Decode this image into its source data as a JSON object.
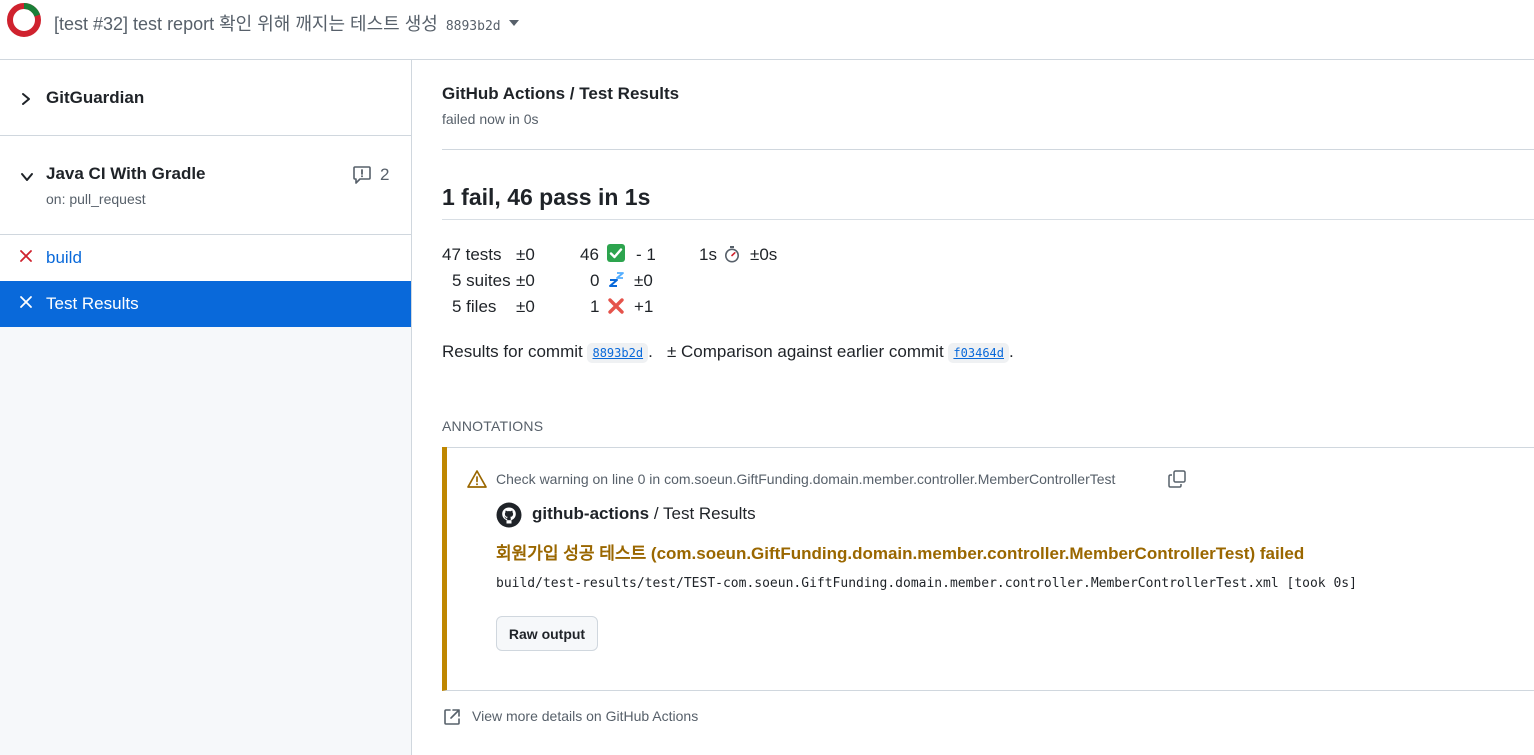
{
  "header": {
    "title": "[test #32] test report 확인 위해 깨지는 테스트 생성",
    "sha": "8893b2d",
    "status_colors": {
      "fail": "#cf222e",
      "pass": "#1a7f37"
    }
  },
  "sidebar": {
    "gitguardian": {
      "label": "GitGuardian"
    },
    "workflow": {
      "label": "Java CI With Gradle",
      "trigger": "on: pull_request",
      "comment_count": "2"
    },
    "jobs": [
      {
        "label": "build",
        "status": "failed",
        "selected": false
      },
      {
        "label": "Test Results",
        "status": "failed",
        "selected": true
      }
    ]
  },
  "main": {
    "check_title": "GitHub Actions / Test Results",
    "check_subtitle": "failed now in 0s",
    "summary_title": "1 fail, 46 pass in 1s",
    "stats": {
      "tests": "47 tests",
      "tests_delta": "±0",
      "suites": "5 suites",
      "suites_delta": "±0",
      "files": "5 files",
      "files_delta": "±0",
      "passed": "46",
      "passed_delta": "- 1",
      "skipped": "0",
      "skipped_delta": "±0",
      "failed": "1",
      "failed_delta": "+1",
      "duration": "1s",
      "duration_delta": "±0s"
    },
    "commit_line": {
      "prefix": "Results for commit",
      "commit": "8893b2d",
      "sep": ".",
      "comparison_prefix": "± Comparison against earlier commit",
      "earlier_commit": "f03464d",
      "suffix": "."
    },
    "annotations_heading": "ANNOTATIONS",
    "annotation": {
      "warning": "Check warning on line 0 in com.soeun.GiftFunding.domain.member.controller.MemberControllerTest",
      "author": "github-actions",
      "author_suffix": "/ Test Results",
      "title": "회원가입 성공 테스트 (com.soeun.GiftFunding.domain.member.controller.MemberControllerTest) failed",
      "file": "build/test-results/test/TEST-com.soeun.GiftFunding.domain.member.controller.MemberControllerTest.xml [took 0s]",
      "button": "Raw output"
    },
    "more_details": "View more details on GitHub Actions"
  }
}
